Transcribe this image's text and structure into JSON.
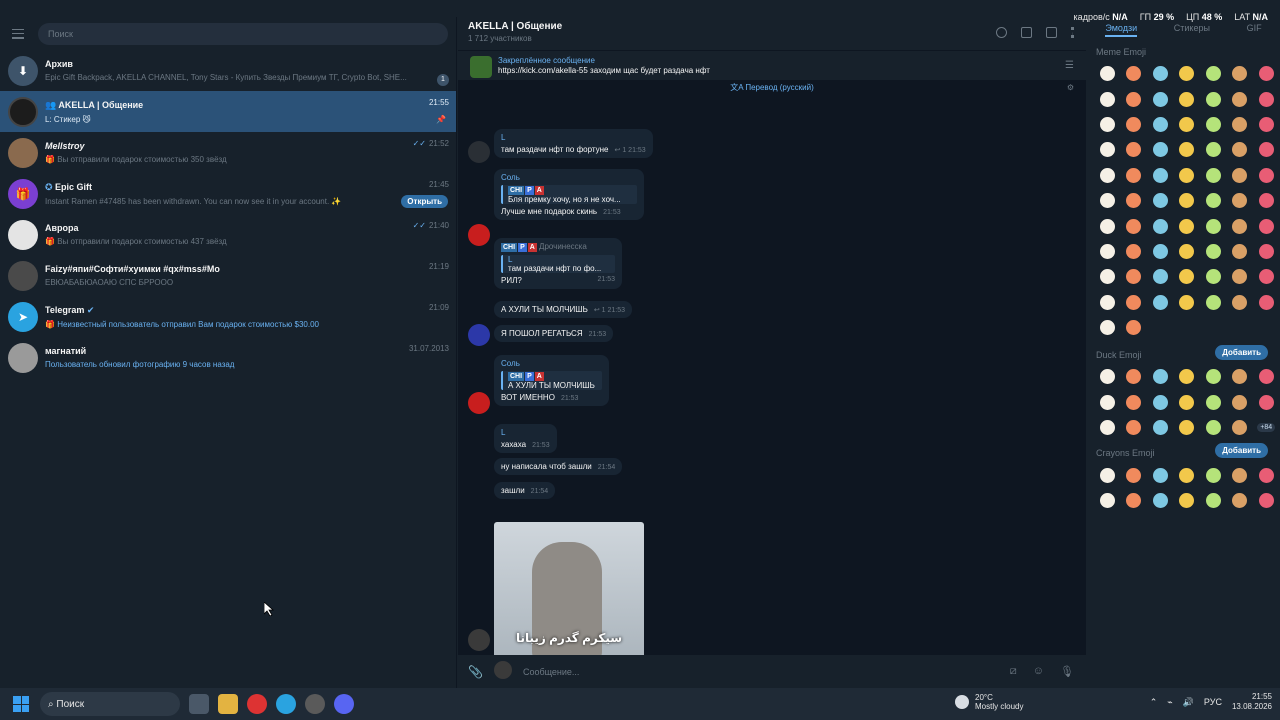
{
  "overlay": {
    "fps_label": "кадров/с",
    "fps_value": "N/A",
    "gpu_label": "ГП",
    "gpu_value": "29 %",
    "cpu_label": "ЦП",
    "cpu_value": "48 %",
    "lat_label": "LAT",
    "lat_value": "N/A"
  },
  "sidebar": {
    "search_placeholder": "Поиск",
    "chats": [
      {
        "name": "Архив",
        "preview": "Epic Gift Backpack, AKELLA CHANNEL, Tony Stars - Купить Звезды Премиум ТГ, Crypto Bot, SHE...",
        "badge": "1",
        "time": ""
      },
      {
        "name": "AKELLA | Общение",
        "preview": "L: Стикер 😼",
        "time": "21:55"
      },
      {
        "name": "Mellstroy",
        "preview": "Вы отправили подарок стоимостью 350 звёзд",
        "time": "21:52"
      },
      {
        "name": "Epic Gift",
        "preview": "Instant Ramen #47485 has been withdrawn. You can now see it in your account. ✨",
        "time": "21:45",
        "button": "Открыть"
      },
      {
        "name": "Аврора",
        "preview": "Вы отправили подарок стоимостью 437 звёзд",
        "time": "21:40"
      },
      {
        "name": "Faizy#япи#Софти#хуимки #qx#mss#Mo",
        "preview": "ЕВЮАБАБЮАОАЮ СПС БРРООО",
        "time": "21:19"
      },
      {
        "name": "Telegram",
        "preview": "Неизвестный пользователь отправил Вам подарок стоимостью $30.00",
        "time": "21:09"
      },
      {
        "name": "магнатий",
        "preview": "Пользователь обновил фотографию 9 часов назад",
        "time": "31.07.2013"
      }
    ]
  },
  "chat": {
    "title": "AKELLA | Общение",
    "subtitle": "1 712 участников",
    "pinned_title": "Закреплённое сообщение",
    "pinned_text": "https://kick.com/akella-55 заходим щас будет раздача нфт",
    "translate": "Перевод (русский)",
    "input_placeholder": "Сообщение...",
    "tags": [
      "СНІ",
      "Р",
      "А"
    ],
    "messages": {
      "m1_name": "L",
      "m1_text": "там раздачи нфт по фортуне",
      "m1_views": "1",
      "m1_time": "21:53",
      "m2_name": "Соль",
      "m2_reply": "Бля премку хочу, но я не хоч...",
      "m2_text": "Лучше мне подарок скинь",
      "m2_time": "21:53",
      "m3_name": "Дрочинесска",
      "m3_reply_name": "L",
      "m3_reply": "там раздачи нфт по фо...",
      "m3_text": "РИЛ?",
      "m3_time": "21:53",
      "m4_text": "А ХУЛИ ТЫ МОЛЧИШЬ",
      "m4_views": "1",
      "m4_time": "21:53",
      "m5_text": "Я ПОШОЛ РЕГАТЬСЯ",
      "m5_time": "21:53",
      "m6_name": "Соль",
      "m6_reply": "А ХУЛИ ТЫ МОЛЧИШЬ",
      "m6_text": "ВОТ ИМЕННО",
      "m6_time": "21:53",
      "m7_name": "L",
      "m7_text": "хахаха",
      "m7_time": "21:53",
      "m8_text": "ну написала чтоб зашли",
      "m8_time": "21:54",
      "m9_text": "зашли",
      "m9_time": "21:54",
      "sticker_caption": "سیکرم گدرم زیبانا"
    }
  },
  "emoji_panel": {
    "tabs": [
      "Эмодзи",
      "Стикеры",
      "GIF"
    ],
    "set1": "Meme Emoji",
    "set2": "Duck Emoji",
    "set3": "Crayons Emoji",
    "add_label": "Добавить",
    "more_count": "+84"
  },
  "taskbar": {
    "search": "Поиск",
    "weather_temp": "20°C",
    "weather_desc": "Mostly cloudy",
    "lang": "РУС",
    "time": "21:55",
    "date": "13.08.2026"
  }
}
